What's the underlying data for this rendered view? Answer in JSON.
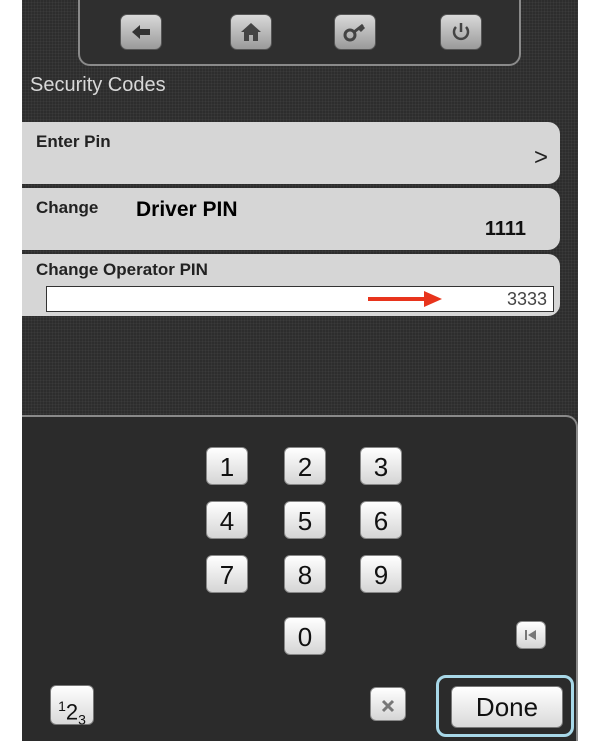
{
  "header": {
    "title": "Security Codes",
    "buttons": [
      {
        "icon": "back-arrow-icon"
      },
      {
        "icon": "home-icon"
      },
      {
        "icon": "key-icon"
      },
      {
        "icon": "power-icon"
      }
    ]
  },
  "rows": {
    "enter_pin": {
      "label": "Enter Pin",
      "chevron": ">"
    },
    "change_driver": {
      "label": "Change",
      "sublabel": "Driver PIN",
      "value": "1111"
    },
    "change_operator": {
      "label": "Change Operator PIN",
      "value": "3333"
    }
  },
  "keypad": {
    "keys": [
      "1",
      "2",
      "3",
      "4",
      "5",
      "6",
      "7",
      "8",
      "9",
      "0"
    ],
    "mode_label_base": "1",
    "mode_label_sub": "2",
    "mode_label_sub2": "3",
    "done_label": "Done",
    "skip_icon": "skip-back-icon",
    "clear_icon": "close-icon"
  },
  "colors": {
    "arrow": "#e8341c",
    "done_highlight": "#a8d8e8"
  }
}
